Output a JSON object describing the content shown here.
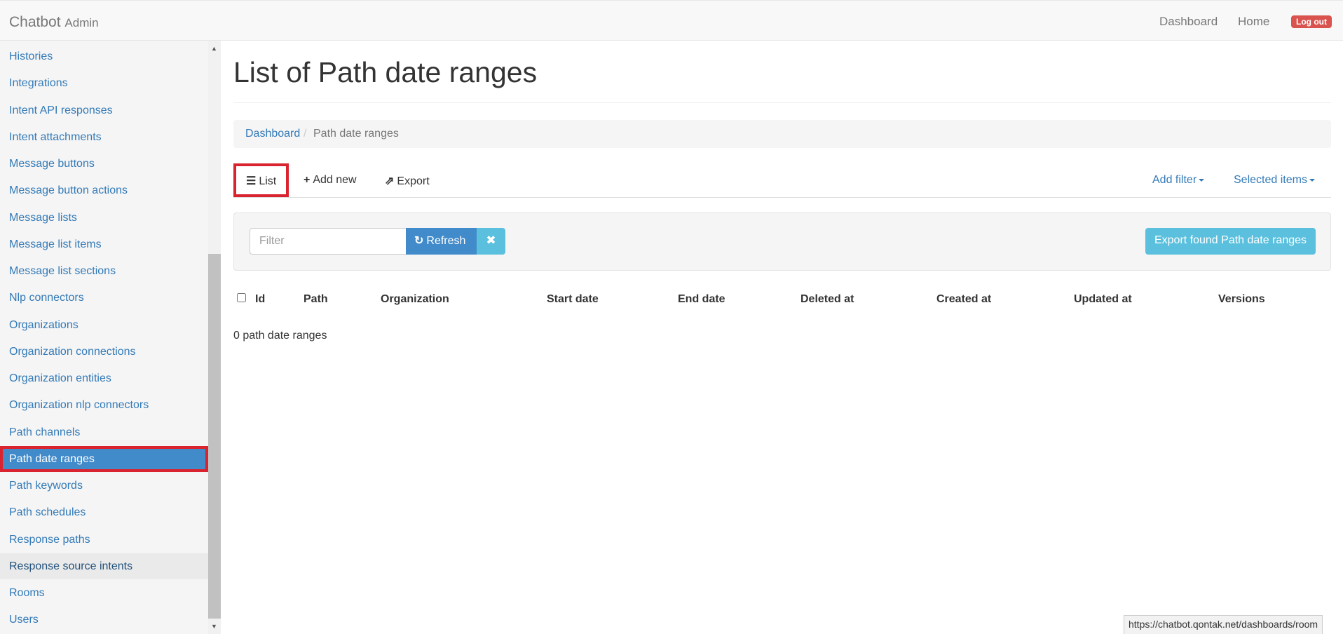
{
  "navbar": {
    "brand": "Chatbot",
    "brand_sub": "Admin",
    "links": [
      "Dashboard",
      "Home"
    ],
    "logout": "Log out"
  },
  "sidebar": {
    "items": [
      {
        "label": "Histories",
        "state": "normal"
      },
      {
        "label": "Integrations",
        "state": "normal"
      },
      {
        "label": "Intent API responses",
        "state": "normal"
      },
      {
        "label": "Intent attachments",
        "state": "normal"
      },
      {
        "label": "Message buttons",
        "state": "normal"
      },
      {
        "label": "Message button actions",
        "state": "normal"
      },
      {
        "label": "Message lists",
        "state": "normal"
      },
      {
        "label": "Message list items",
        "state": "normal"
      },
      {
        "label": "Message list sections",
        "state": "normal"
      },
      {
        "label": "Nlp connectors",
        "state": "normal"
      },
      {
        "label": "Organizations",
        "state": "normal"
      },
      {
        "label": "Organization connections",
        "state": "normal"
      },
      {
        "label": "Organization entities",
        "state": "normal"
      },
      {
        "label": "Organization nlp connectors",
        "state": "normal"
      },
      {
        "label": "Path channels",
        "state": "normal"
      },
      {
        "label": "Path date ranges",
        "state": "active"
      },
      {
        "label": "Path keywords",
        "state": "normal"
      },
      {
        "label": "Path schedules",
        "state": "normal"
      },
      {
        "label": "Response paths",
        "state": "normal"
      },
      {
        "label": "Response source intents",
        "state": "hover"
      },
      {
        "label": "Rooms",
        "state": "normal"
      },
      {
        "label": "Users",
        "state": "normal"
      }
    ]
  },
  "main": {
    "title": "List of Path date ranges",
    "breadcrumb": {
      "link": "Dashboard",
      "separator": "/",
      "current": "Path date ranges"
    },
    "tabs": [
      {
        "label": "List",
        "icon": "list-icon",
        "glyph": "☰",
        "active": true
      },
      {
        "label": "Add new",
        "icon": "plus-icon",
        "glyph": "+",
        "active": false
      },
      {
        "label": "Export",
        "icon": "share-icon",
        "glyph": "⇗",
        "active": false
      }
    ],
    "right_menus": [
      "Add filter",
      "Selected items"
    ],
    "filter": {
      "placeholder": "Filter",
      "value": "",
      "refresh_label": "Refresh",
      "refresh_icon": "↻",
      "clear_icon": "✖",
      "export_found_label": "Export found Path date ranges"
    },
    "table": {
      "columns": [
        "Id",
        "Path",
        "Organization",
        "Start date",
        "End date",
        "Deleted at",
        "Created at",
        "Updated at",
        "Versions"
      ],
      "count_text": "0 path date ranges"
    }
  },
  "statusbar": {
    "url": "https://chatbot.qontak.net/dashboards/room"
  },
  "colors": {
    "link": "#337ab7",
    "active_bg": "#428bca",
    "highlight_border": "#d9232f",
    "info": "#5bc0de",
    "danger": "#d9534f"
  }
}
